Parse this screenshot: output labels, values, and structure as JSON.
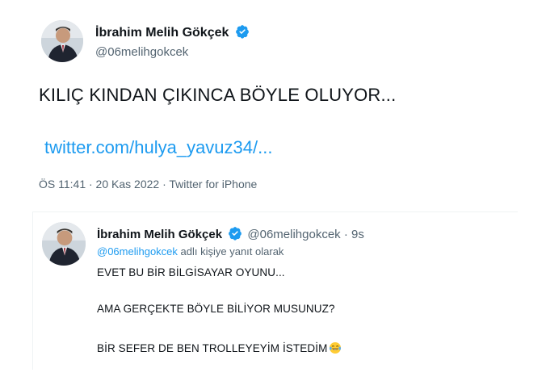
{
  "main_tweet": {
    "author_name": "İbrahim Melih Gökçek",
    "handle": "@06melihgokcek",
    "text": "KILIÇ KINDAN ÇIKINCA BÖYLE OLUYOR...",
    "link": "twitter.com/hulya_yavuz34/...",
    "meta": "ÖS 11:41 · 20 Kas 2022 · Twitter for iPhone",
    "avatar_icon": "profile-avatar",
    "verified_icon": "verified-badge-icon"
  },
  "reply_tweet": {
    "author_name": "İbrahim Melih Gökçek",
    "handle_time": "@06melihgokcek · 9s",
    "reply_to_mention": "@06melihgokcek",
    "reply_to_suffix": " adlı kişiye yanıt olarak",
    "lines": [
      "EVET BU BİR BİLGİSAYAR OYUNU...",
      "AMA GERÇEKTE BÖYLE BİLİYOR MUSUNUZ?",
      "BİR SEFER DE BEN TROLLEYEYİM İSTEDİM"
    ],
    "emoji_icon": "laughing-tears-emoji"
  },
  "colors": {
    "link": "#1d9bf0",
    "secondary_text": "#536471",
    "primary_text": "#0f1419",
    "verified": "#1d9bf0"
  }
}
